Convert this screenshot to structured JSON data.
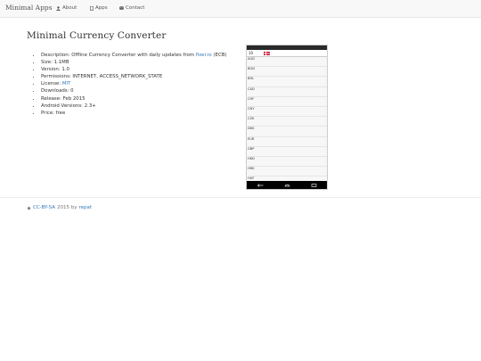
{
  "navbar": {
    "brand": "Minimal Apps",
    "links": [
      {
        "label": "About",
        "icon": "user-icon"
      },
      {
        "label": "Apps",
        "icon": "phone-icon"
      },
      {
        "label": "Contact",
        "icon": "envelope-icon"
      }
    ]
  },
  "page": {
    "title": "Minimal Currency Converter"
  },
  "details": {
    "description_prefix": "Description: Offline Currency Converter with daily updates from",
    "description_link": "fixer.io",
    "description_suffix": "(ECB)",
    "size": "Size: 1.1MB",
    "version": "Version: 1.0",
    "permissions": "Permissions: INTERNET, ACCESS_NETWORK_STATE",
    "license_prefix": "License:",
    "license_link": "MIT",
    "downloads": "Downloads: 0",
    "release": "Release: Feb 2015",
    "android_versions": "Android Versions: 2.3+",
    "price": "Price: free"
  },
  "footer": {
    "icon": "star-icon",
    "license_link": "CC-BY-SA",
    "year_by": "2015 by",
    "author_link": "repat"
  },
  "screenshot": {
    "amount": "10",
    "clock": "",
    "currencies": [
      {
        "code": "AUD",
        "value": ""
      },
      {
        "code": "BGN",
        "value": ""
      },
      {
        "code": "BRL",
        "value": ""
      },
      {
        "code": "CAD",
        "value": ""
      },
      {
        "code": "CHF",
        "value": ""
      },
      {
        "code": "CNY",
        "value": ""
      },
      {
        "code": "CZK",
        "value": ""
      },
      {
        "code": "DKK",
        "value": ""
      },
      {
        "code": "EUR",
        "value": ""
      },
      {
        "code": "GBP",
        "value": ""
      },
      {
        "code": "HKD",
        "value": ""
      },
      {
        "code": "HRK",
        "value": ""
      },
      {
        "code": "HUF",
        "value": ""
      }
    ],
    "colors": {
      "status_bar": "#2a2a2a",
      "flag_red": "#c8102e"
    }
  },
  "colors": {
    "link": "#337ab7",
    "navbar_bg": "#f8f8f8"
  }
}
